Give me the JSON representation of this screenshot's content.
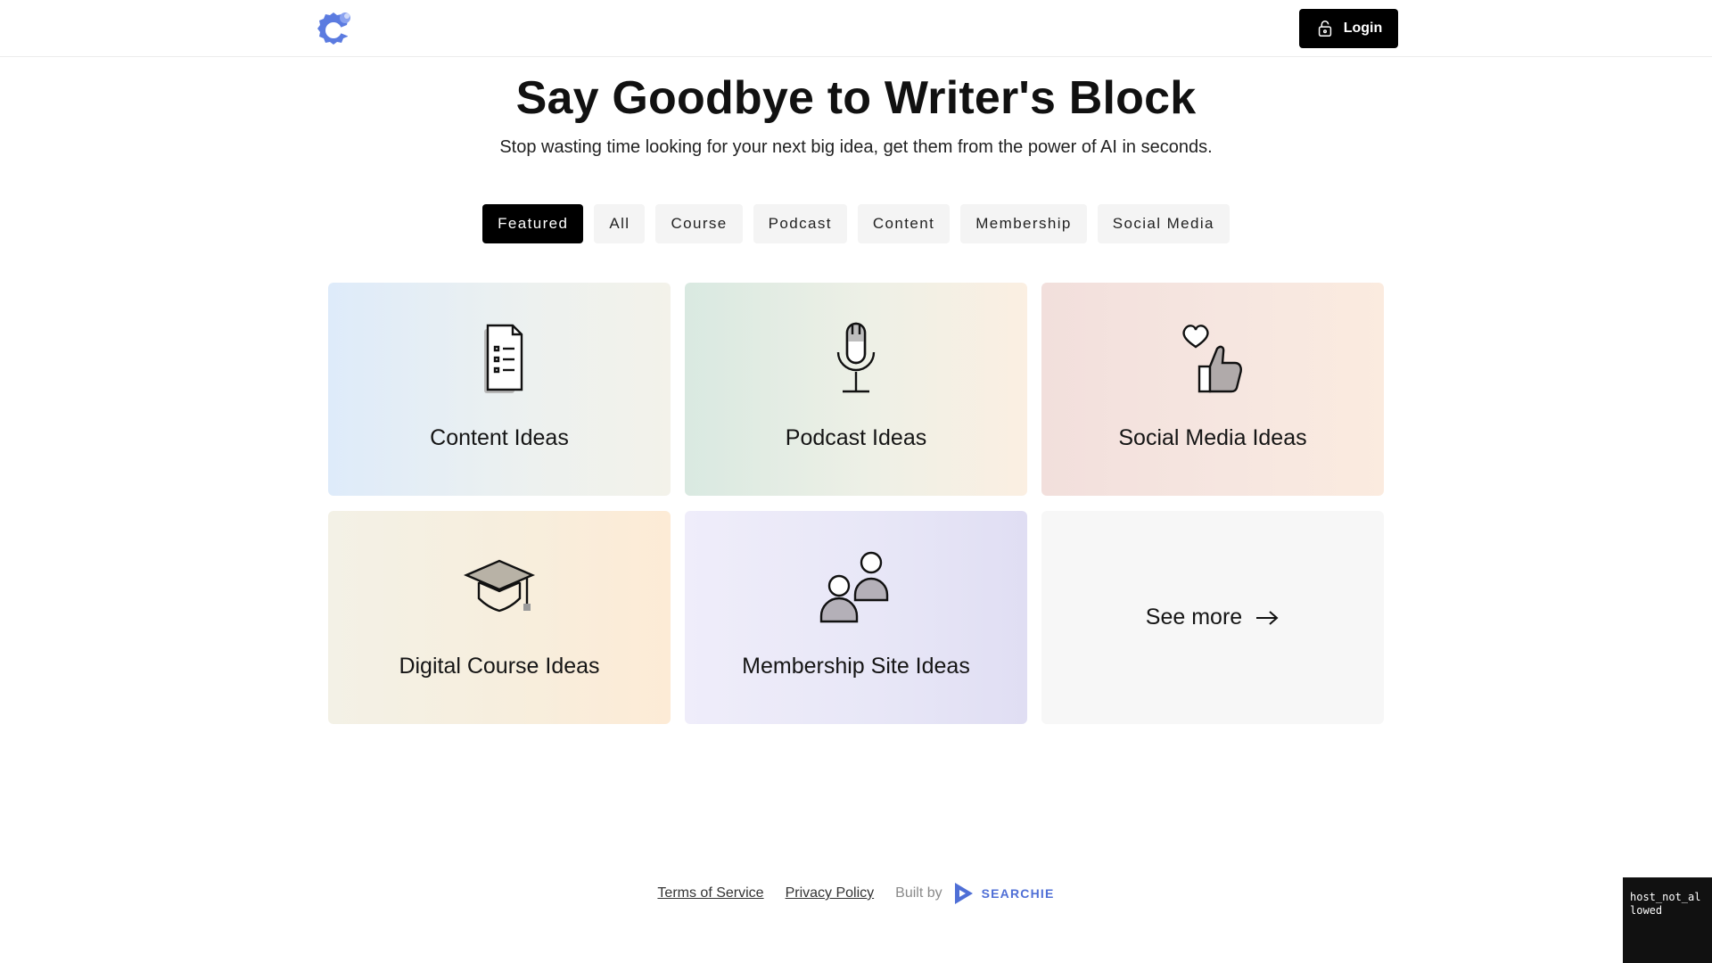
{
  "header": {
    "logo_icon": "brand-gear-logo-icon",
    "login_label": "Login",
    "login_icon": "unlock-icon"
  },
  "hero": {
    "title": "Say Goodbye to Writer's Block",
    "subtitle": "Stop wasting time looking for your next big idea, get them from the power of AI in seconds."
  },
  "tabs": [
    {
      "label": "Featured",
      "active": true
    },
    {
      "label": "All",
      "active": false
    },
    {
      "label": "Course",
      "active": false
    },
    {
      "label": "Podcast",
      "active": false
    },
    {
      "label": "Content",
      "active": false
    },
    {
      "label": "Membership",
      "active": false
    },
    {
      "label": "Social Media",
      "active": false
    }
  ],
  "cards": [
    {
      "label": "Content Ideas",
      "icon": "document-list-icon"
    },
    {
      "label": "Podcast Ideas",
      "icon": "microphone-icon"
    },
    {
      "label": "Social Media Ideas",
      "icon": "heart-thumbs-up-icon"
    },
    {
      "label": "Digital Course Ideas",
      "icon": "graduation-cap-icon"
    },
    {
      "label": "Membership Site Ideas",
      "icon": "people-icon"
    },
    {
      "label": "See more",
      "icon": "arrow-right-icon"
    }
  ],
  "footer": {
    "terms": "Terms of Service",
    "privacy": "Privacy Policy",
    "built_by": "Built by",
    "brand": "SEARCHIE"
  },
  "overlay": {
    "host_text": "host_not_allowed"
  },
  "colors": {
    "accent": "#000000",
    "brand_blue": "#4f6fd6",
    "logo_blue": "#5b7be0"
  }
}
